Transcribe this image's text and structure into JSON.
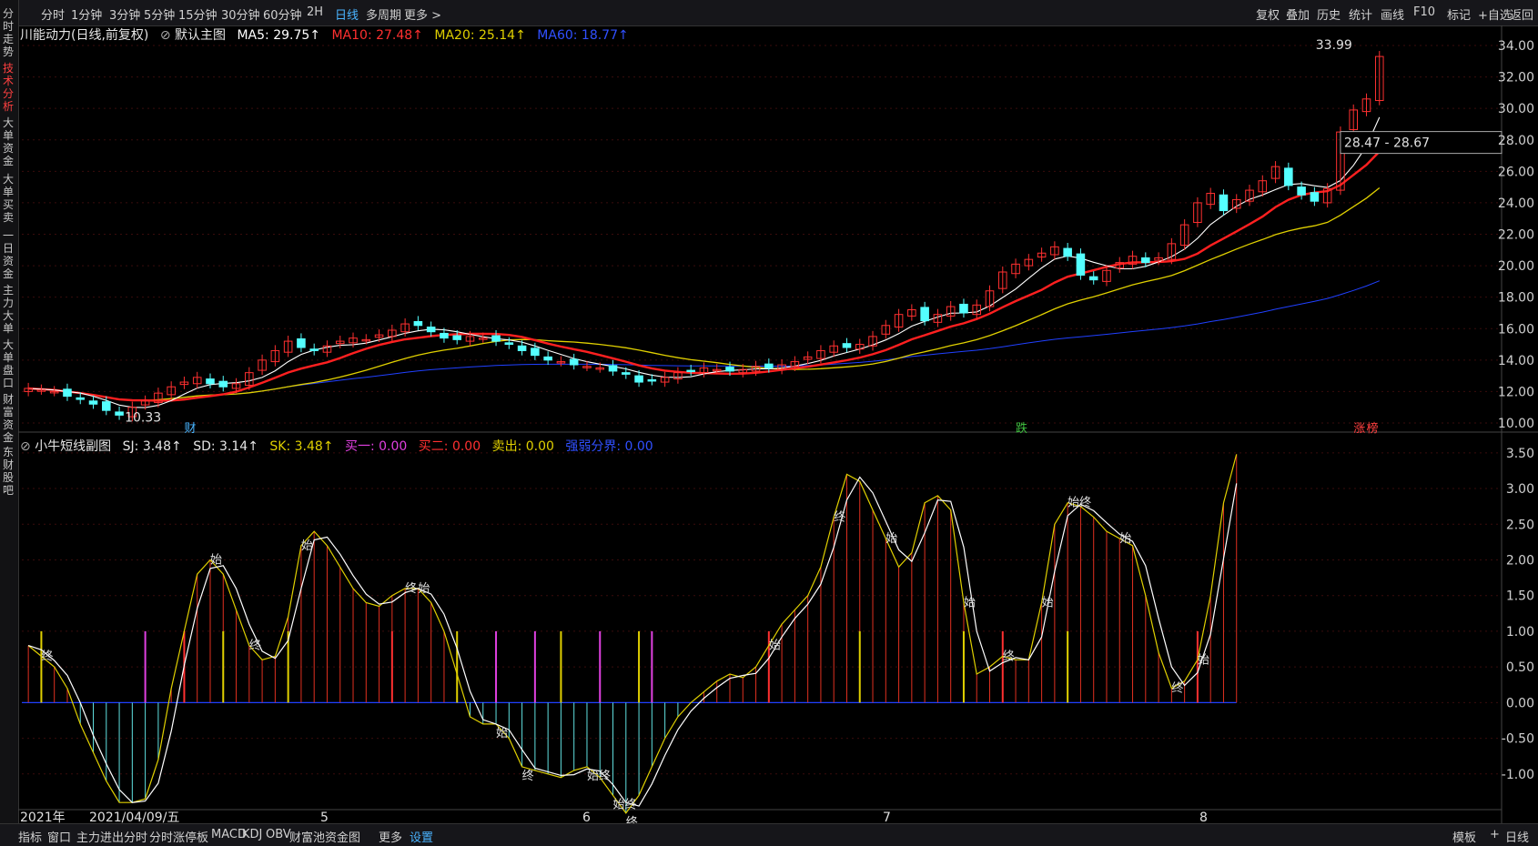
{
  "toolbar": {
    "left": [
      "分时",
      "1分钟",
      "3分钟",
      "5分钟",
      "15分钟",
      "30分钟",
      "60分钟",
      "2H",
      "日线",
      "多周期",
      "更多 >"
    ],
    "right": [
      "复权",
      "叠加",
      "历史",
      "统计",
      "画线",
      "F10",
      "标记",
      "+自选",
      "返回"
    ]
  },
  "vtabs": [
    "分时走势",
    "技术分析",
    "大单资金",
    "大单买卖",
    "一日资金",
    "主力大单",
    "大单盘口",
    "财富资金",
    "东财股吧"
  ],
  "main_legend": {
    "name": "川能动力(日线,前复权)",
    "template": "默认主图",
    "ma5": "MA5: 29.75↑",
    "ma10": "MA10: 27.48↑",
    "ma20": "MA20: 25.14↑",
    "ma60": "MA60: 18.77↑"
  },
  "sub_legend": {
    "name": "小牛短线副图",
    "sj": "SJ: 3.48↑",
    "sd": "SD: 3.14↑",
    "sk": "SK: 3.48↑",
    "buy1": "买一: 0.00",
    "buy2": "买二: 0.00",
    "sell": "卖出: 0.00",
    "strong": "强弱分界: 0.00"
  },
  "annotations": {
    "high": "33.99",
    "low": "10.33",
    "range": "28.47 - 28.67",
    "badge_cai": "财",
    "badge_die": "跌",
    "badge_zhang": "涨",
    "badge_bang": "榜"
  },
  "bottom": {
    "tabs": [
      "指标",
      "窗口",
      "主力进出分时",
      "分时涨停板",
      "MACD",
      "KDJ",
      "OBV",
      "财富池资金图",
      "更多",
      "设置"
    ],
    "right": [
      "模板",
      "+",
      "日线"
    ]
  },
  "xaxis": {
    "year": "2021年",
    "date": "2021/04/09/五",
    "months": [
      "5",
      "6",
      "7",
      "8"
    ]
  },
  "colors": {
    "up": "#ff3030",
    "down": "#54ffff",
    "ma5": "#ffffff",
    "ma10": "#ff2020",
    "ma20": "#e0d000",
    "ma60": "#2040ff"
  },
  "chart_data": [
    {
      "type": "candlestick",
      "title": "川能动力(日线,前复权)",
      "ylim": [
        10.0,
        34.0
      ],
      "yticks": [
        "34.00",
        "32.00",
        "30.00",
        "28.00",
        "26.00",
        "24.00",
        "22.00",
        "20.00",
        "18.00",
        "16.00",
        "14.00",
        "12.00",
        "10.00"
      ],
      "x_labels": [
        "2021年",
        "5",
        "6",
        "7",
        "8"
      ],
      "close": [
        12.2,
        12.1,
        12.0,
        11.7,
        11.5,
        11.2,
        10.8,
        10.5,
        11.0,
        11.4,
        11.9,
        12.3,
        12.6,
        12.9,
        12.5,
        12.3,
        12.5,
        13.2,
        14.0,
        14.6,
        15.2,
        14.8,
        14.6,
        14.9,
        15.2,
        15.4,
        15.3,
        15.6,
        15.9,
        16.3,
        16.2,
        15.8,
        15.4,
        15.3,
        15.5,
        15.4,
        15.2,
        15.0,
        14.6,
        14.3,
        14.0,
        13.9,
        13.7,
        13.6,
        13.5,
        13.3,
        13.1,
        12.6,
        12.7,
        12.9,
        13.2,
        13.3,
        13.5,
        13.4,
        13.3,
        13.4,
        13.6,
        13.5,
        13.7,
        13.9,
        14.2,
        14.6,
        14.9,
        14.8,
        15.0,
        15.5,
        16.2,
        16.9,
        17.2,
        16.5,
        16.9,
        17.4,
        17.0,
        17.5,
        18.4,
        19.6,
        20.1,
        20.4,
        20.8,
        21.2,
        20.6,
        19.4,
        19.1,
        19.7,
        20.2,
        20.6,
        20.2,
        20.5,
        21.4,
        22.6,
        24.0,
        24.6,
        23.5,
        24.2,
        24.8,
        25.4,
        26.3,
        25.1,
        24.5,
        24.1,
        24.9,
        28.5,
        29.9,
        30.6,
        33.3
      ],
      "ma5_last": 29.75,
      "ma10_last": 27.48,
      "ma20_last": 25.14,
      "ma60_last": 18.77
    },
    {
      "type": "bar",
      "title": "小牛短线副图",
      "ylim": [
        -1.5,
        3.6
      ],
      "yticks": [
        "3.50",
        "3.00",
        "2.50",
        "2.00",
        "1.50",
        "1.00",
        "0.50",
        "0.00",
        "-0.50",
        "-1.00"
      ],
      "values": [
        0.8,
        0.65,
        0.5,
        0.2,
        -0.3,
        -0.7,
        -1.1,
        -1.4,
        -1.4,
        -1.35,
        -0.8,
        0.2,
        1.0,
        1.8,
        2.0,
        1.8,
        1.3,
        0.8,
        0.6,
        0.65,
        1.2,
        2.2,
        2.4,
        2.2,
        1.9,
        1.6,
        1.4,
        1.35,
        1.5,
        1.6,
        1.6,
        1.4,
        1.0,
        0.4,
        -0.2,
        -0.3,
        -0.3,
        -0.5,
        -0.9,
        -0.95,
        -1.0,
        -1.05,
        -0.95,
        -0.9,
        -1.05,
        -1.3,
        -1.55,
        -1.3,
        -0.9,
        -0.5,
        -0.2,
        0.0,
        0.15,
        0.3,
        0.4,
        0.35,
        0.5,
        0.8,
        1.1,
        1.3,
        1.5,
        1.9,
        2.6,
        3.2,
        3.1,
        2.7,
        2.3,
        1.9,
        2.1,
        2.8,
        2.9,
        2.7,
        1.4,
        0.4,
        0.5,
        0.65,
        0.6,
        0.6,
        1.4,
        2.5,
        2.8,
        2.75,
        2.6,
        2.4,
        2.3,
        2.2,
        1.5,
        0.7,
        0.2,
        0.3,
        0.6,
        1.5,
        2.8,
        3.48
      ],
      "series": [
        {
          "name": "SJ",
          "last": 3.48
        },
        {
          "name": "SD",
          "last": 3.14
        },
        {
          "name": "SK",
          "last": 3.48
        }
      ],
      "markers": [
        "终",
        "始",
        "终",
        "始",
        "终",
        "始",
        "始",
        "终",
        "始终",
        "始终",
        "终",
        "始",
        "终",
        "始",
        "始",
        "终",
        "始",
        "始终",
        "始",
        "终",
        "始"
      ]
    }
  ]
}
